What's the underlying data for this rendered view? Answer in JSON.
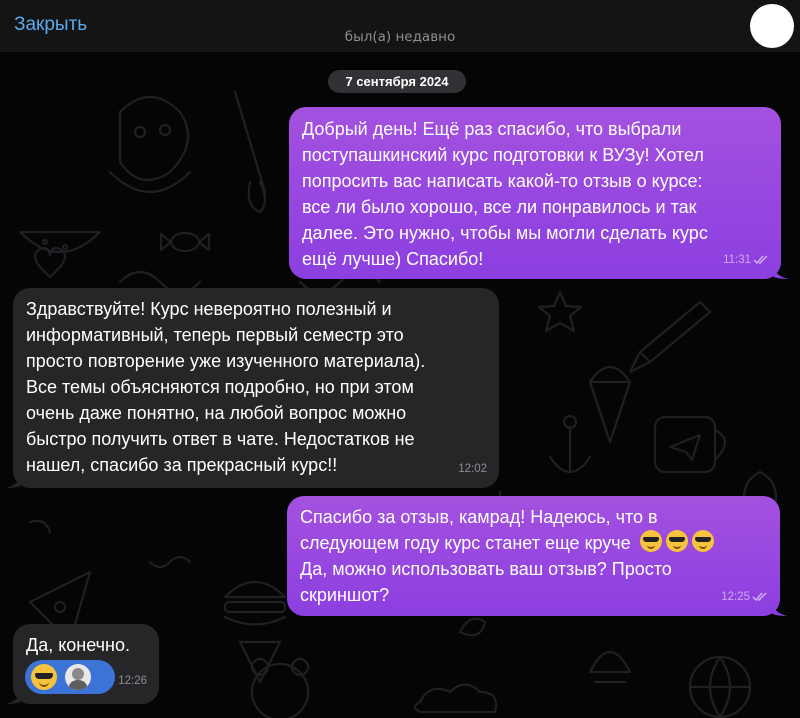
{
  "header": {
    "close_label": "Закрыть",
    "status": "был(а) недавно"
  },
  "date_separator": "7 сентября 2024",
  "messages": [
    {
      "direction": "outgoing",
      "text": "Добрый день! Ещё раз спасибо, что выбрали\nпоступашкинский курс подготовки к ВУЗу! Хотел\nпопросить вас написать какой-то отзыв о курсе:\nвсе ли было хорошо, все ли понравилось и так\nдалее. Это нужно, чтобы мы могли сделать курс\nещё лучше) Спасибо!",
      "time": "11:31",
      "read": true
    },
    {
      "direction": "incoming",
      "text": "Здравствуйте! Курс невероятно полезный и\nинформативный, теперь первый семестр это\nпросто повторение уже изученного материала).\nВсе темы объясняются подробно, но при этом\nочень даже понятно, на любой вопрос можно\nбыстро получить ответ в чате. Недостатков не\nнашел, спасибо за прекрасный курс!!",
      "time": "12:02"
    },
    {
      "direction": "outgoing",
      "text_line1": "Спасибо за отзыв, камрад! Надеюсь, что в",
      "text_line2": "следующем году курс станет еще круче",
      "emoji": "😎😎😎",
      "text_line3": "Да, можно использовать ваш отзыв? Просто\nскриншот?",
      "time": "12:25",
      "read": true
    },
    {
      "direction": "incoming",
      "text": "Да, конечно.",
      "time": "12:26",
      "reaction": {
        "emoji": "sunglasses-emoji-icon",
        "reactor": "user-avatar"
      }
    }
  ],
  "colors": {
    "outgoing_bubble": "#9a47e0",
    "incoming_bubble": "#262629",
    "accent": "#5aa9f0",
    "reaction_bg": "#3c73d6"
  }
}
